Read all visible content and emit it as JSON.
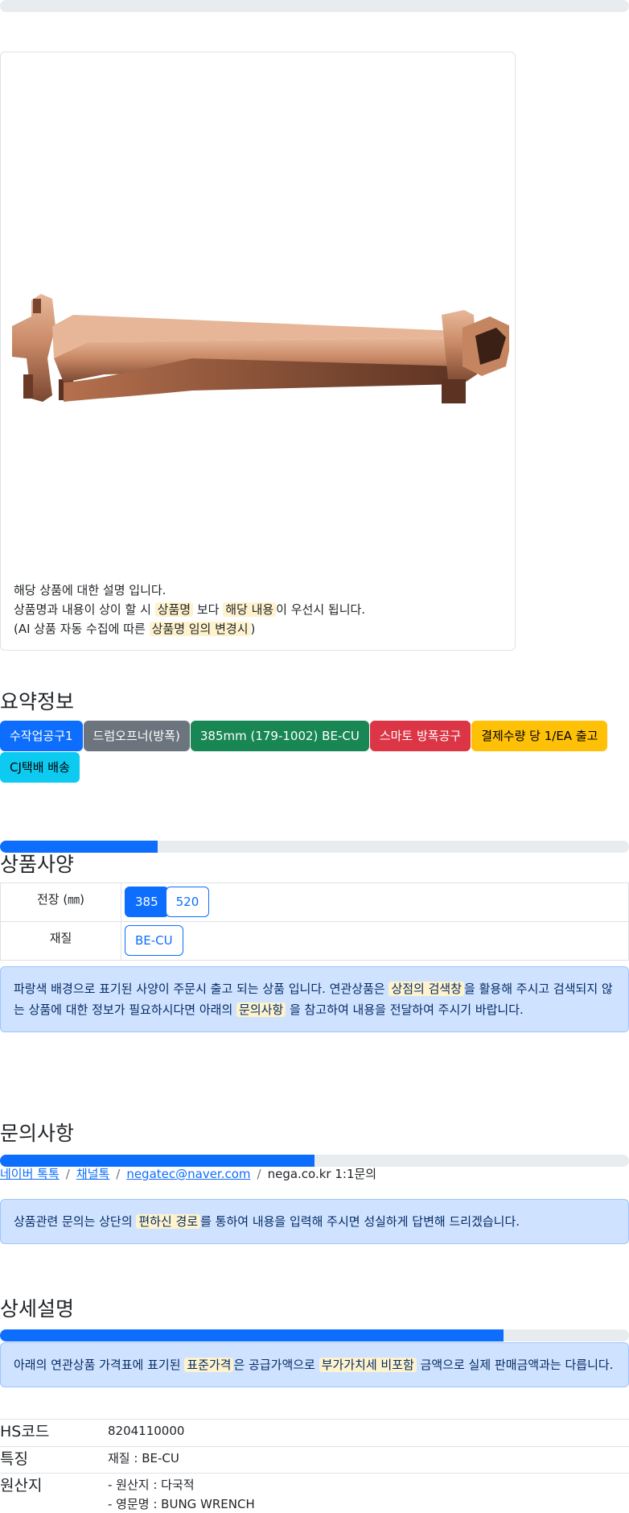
{
  "progress_bars": {
    "top_fraction": 0.0,
    "spec_fraction": 0.25,
    "inquiry_fraction": 0.5,
    "detail_fraction": 0.8
  },
  "image_card": {
    "image_alt_icon": "bung-wrench-product-image",
    "notes": {
      "line1": "해당 상품에 대한 설명 입니다.",
      "line2_prefix": "상품명과 내용이 상이 할 시 ",
      "line2_hl1": "상품명",
      "line2_mid": " 보다 ",
      "line2_hl2": "해당 내용",
      "line2_suffix": "이 우선시 됩니다.",
      "line3_prefix": "(AI 상품 자동 수집에 따른 ",
      "line3_hl": "상품명 임의 변경시",
      "line3_suffix": ")"
    }
  },
  "summary": {
    "title": "요약정보",
    "badges": [
      {
        "label": "수작업공구1",
        "bg": "#0d6efd",
        "fg": "#ffffff"
      },
      {
        "label": "드럼오프너(방폭)",
        "bg": "#6c757d",
        "fg": "#ffffff"
      },
      {
        "label": "385mm (179-1002) BE-CU",
        "bg": "#198754",
        "fg": "#ffffff"
      },
      {
        "label": "스마토 방폭공구",
        "bg": "#dc3545",
        "fg": "#ffffff"
      },
      {
        "label": "결제수량 당 1/EA 출고",
        "bg": "#ffc107",
        "fg": "#000000"
      },
      {
        "label": "CJ택배 배송",
        "bg": "#0dcaf0",
        "fg": "#000000"
      }
    ]
  },
  "spec": {
    "title": "상품사양",
    "rows": [
      {
        "label": "전장 (㎜)",
        "options": [
          {
            "label": "385",
            "active": true
          },
          {
            "label": "520",
            "active": false
          }
        ]
      },
      {
        "label": "재질",
        "options": [
          {
            "label": "BE-CU",
            "active": false
          }
        ]
      }
    ],
    "alert": {
      "prefix": "파랑색 배경으로 표기된 사양이 주문시 출고 되는 상품 입니다. 연관상품은 ",
      "hl1": "상점의 검색창",
      "mid": "을 활용해 주시고 검색되지 않는 상품에 대한 정보가 필요하시다면 아래의 ",
      "hl2": "문의사항",
      "suffix": " 을 참고하여 내용을 전달하여 주시기 바랍니다."
    }
  },
  "inquiry": {
    "title": "문의사항",
    "links": [
      "네이버 톡톡",
      "채널톡",
      "negatec@naver.com"
    ],
    "plain": "nega.co.kr 1:1문의",
    "separator": "/",
    "alert": {
      "prefix": "상품관련 문의는 상단의 ",
      "hl": "편하신 경로",
      "suffix": "를 통하여 내용을 입력해 주시면 성실하게 답변해 드리겠습니다."
    }
  },
  "detail": {
    "title": "상세설명",
    "alert": {
      "prefix": "아래의 연관상품 가격표에 표기된 ",
      "hl1": "표준가격",
      "mid": "은 공급가액으로 ",
      "hl2": "부가가치세 비포함",
      "suffix": " 금액으로 실제 판매금액과는 다릅니다."
    },
    "info": [
      {
        "key": "HS코드",
        "lines": [
          "8204110000"
        ]
      },
      {
        "key": "특징",
        "lines": [
          "재질 : BE-CU"
        ]
      },
      {
        "key": "원산지",
        "lines": [
          "- 원산지 : 다국적",
          "- 영문명 : BUNG WRENCH"
        ]
      }
    ]
  }
}
